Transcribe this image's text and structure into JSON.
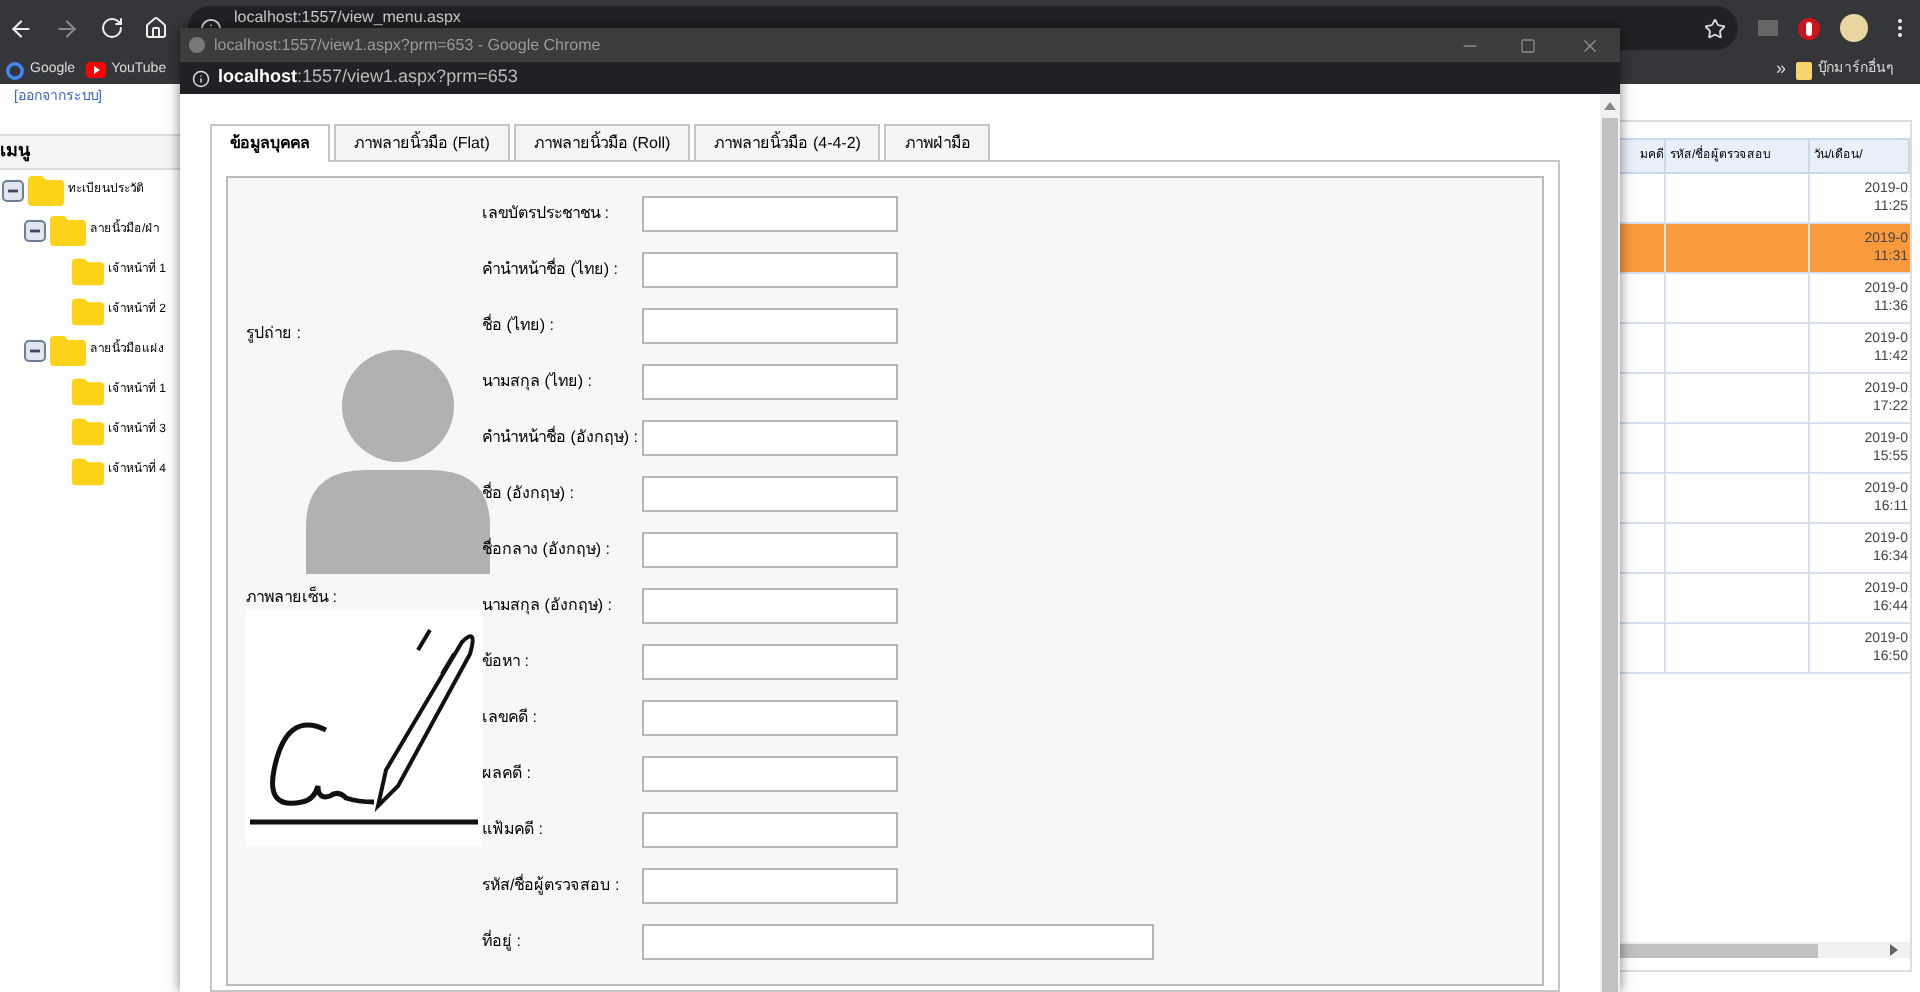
{
  "browser": {
    "address": "localhost:1557/view_menu.aspx",
    "bookmarks": [
      "Google",
      "YouTube"
    ],
    "more": "»",
    "other_bookmarks": "บุ๊กมาร์กอื่นๆ"
  },
  "page": {
    "logout_link": "[ออกจากระบบ]",
    "menu_title": "เมนู",
    "tree": [
      {
        "label": "ทะเบียนประวัติ",
        "expanded": true,
        "children": [
          {
            "label": "ลายนิ้วมือ/ฝ่า",
            "expanded": true,
            "children": [
              {
                "label": "เจ้าหน้าที่ 1"
              },
              {
                "label": "เจ้าหน้าที่ 2"
              }
            ]
          },
          {
            "label": "ลายนิ้วมือแฝง",
            "expanded": true,
            "children": [
              {
                "label": "เจ้าหน้าที่ 1"
              },
              {
                "label": "เจ้าหน้าที่ 3"
              },
              {
                "label": "เจ้าหน้าที่ 4"
              }
            ]
          }
        ]
      }
    ],
    "table": {
      "columns": [
        "มคดี",
        "รหัส/ชื่อผู้ตรวจสอบ",
        "วัน/เดือน/"
      ],
      "rows": [
        {
          "date": "2019-0",
          "time": "11:25",
          "selected": false
        },
        {
          "date": "2019-0",
          "time": "11:31",
          "selected": true
        },
        {
          "date": "2019-0",
          "time": "11:36",
          "selected": false
        },
        {
          "date": "2019-0",
          "time": "11:42",
          "selected": false
        },
        {
          "date": "2019-0",
          "time": "17:22",
          "selected": false
        },
        {
          "date": "2019-0",
          "time": "15:55",
          "selected": false
        },
        {
          "date": "2019-0",
          "time": "16:11",
          "selected": false
        },
        {
          "date": "2019-0",
          "time": "16:34",
          "selected": false
        },
        {
          "date": "2019-0",
          "time": "16:44",
          "selected": false
        },
        {
          "date": "2019-0",
          "time": "16:50",
          "selected": false
        }
      ]
    }
  },
  "popup": {
    "title": "localhost:1557/view1.aspx?prm=653 - Google Chrome",
    "address_host": "localhost",
    "address_rest": ":1557/view1.aspx?prm=653",
    "tabs": [
      {
        "label": "ข้อมูลบุคคล",
        "selected": true
      },
      {
        "label": "ภาพลายนิ้วมือ (Flat)",
        "selected": false
      },
      {
        "label": "ภาพลายนิ้วมือ (Roll)",
        "selected": false
      },
      {
        "label": "ภาพลายนิ้วมือ (4-4-2)",
        "selected": false
      },
      {
        "label": "ภาพฝ่ามือ",
        "selected": false
      }
    ],
    "photo_label": "รูปถ่าย :",
    "signature_label": "ภาพลายเซ็น :",
    "fields": [
      {
        "label": "เลขบัตรประชาชน :",
        "wide": false
      },
      {
        "label": "คำนำหน้าชื่อ (ไทย) :",
        "wide": false
      },
      {
        "label": "ชื่อ (ไทย) :",
        "wide": false
      },
      {
        "label": "นามสกุล (ไทย) :",
        "wide": false
      },
      {
        "label": "คำนำหน้าชื่อ (อังกฤษ) :",
        "wide": false
      },
      {
        "label": "ชื่อ (อังกฤษ) :",
        "wide": false
      },
      {
        "label": "ชื่อกลาง (อังกฤษ) :",
        "wide": false
      },
      {
        "label": "นามสกุล (อังกฤษ) :",
        "wide": false
      },
      {
        "label": "ข้อหา :",
        "wide": false
      },
      {
        "label": "เลขคดี :",
        "wide": false
      },
      {
        "label": "ผลคดี :",
        "wide": false
      },
      {
        "label": "แฟ้มคดี :",
        "wide": false
      },
      {
        "label": "รหัส/ชื่อผู้ตรวจสอบ :",
        "wide": false
      },
      {
        "label": "ที่อยู่ :",
        "wide": true
      }
    ]
  }
}
